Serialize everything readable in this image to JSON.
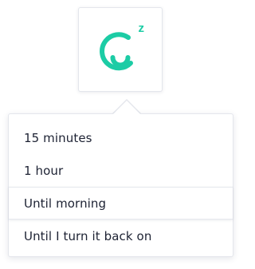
{
  "app": {
    "name": "Snooze",
    "accent_color": "#1ccca5",
    "icon": "snooze-smiley-icon",
    "badge_text": "z"
  },
  "menu": {
    "items": [
      {
        "label": "15 minutes",
        "active": false
      },
      {
        "label": "1 hour",
        "active": false
      },
      {
        "label": "Until morning",
        "active": true
      },
      {
        "label": "Until I turn it back on",
        "active": false
      }
    ]
  }
}
